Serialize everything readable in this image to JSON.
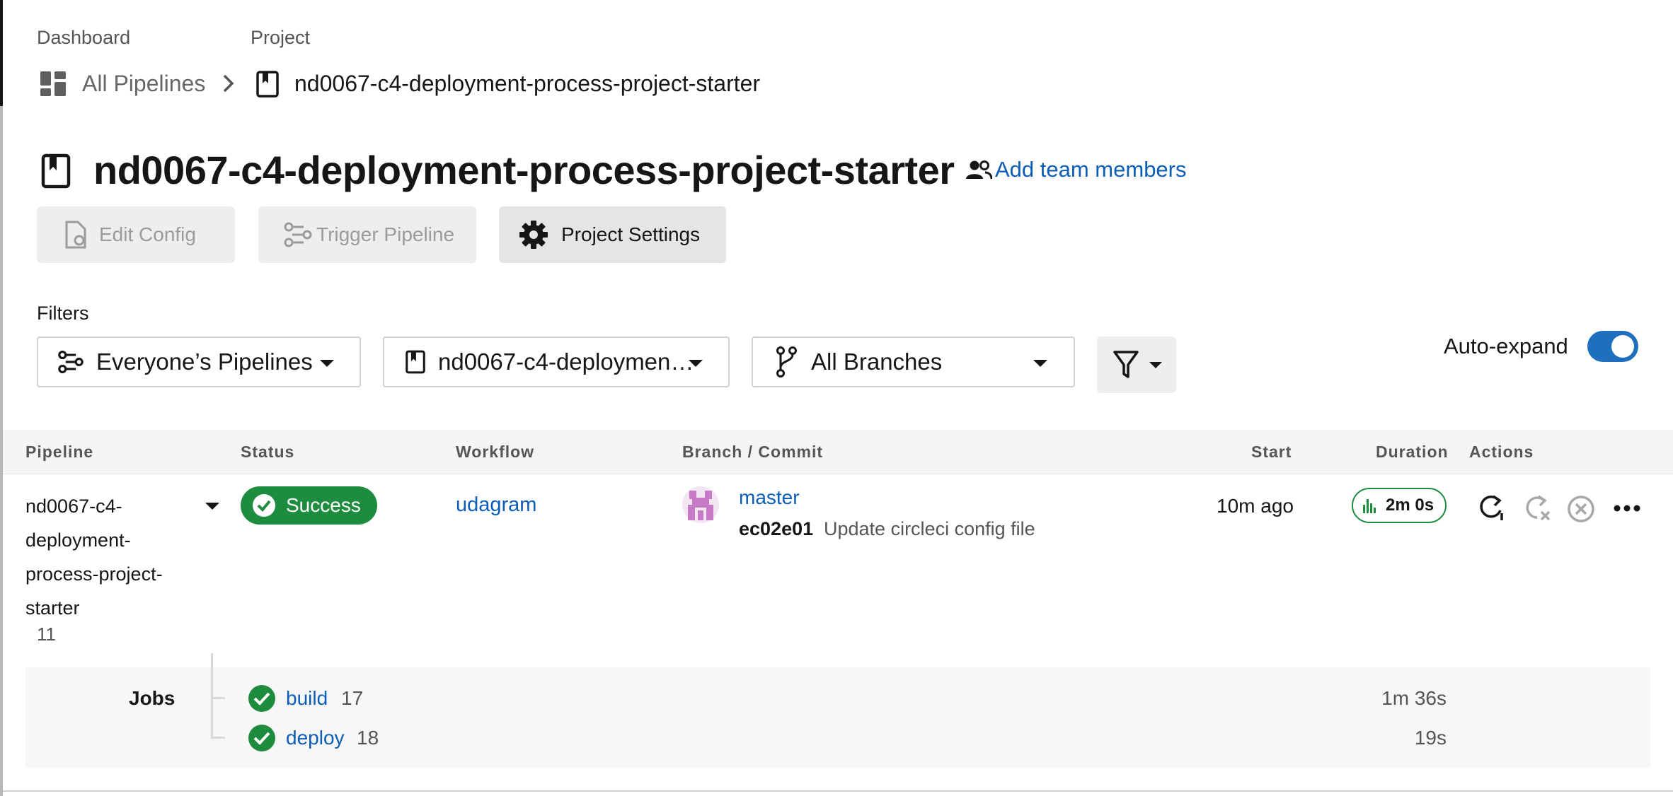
{
  "breadcrumb": {
    "dashboard_label": "Dashboard",
    "project_label": "Project",
    "all_pipelines": "All Pipelines",
    "project_name": "nd0067-c4-deployment-process-project-starter"
  },
  "header": {
    "title": "nd0067-c4-deployment-process-project-starter",
    "add_team": "Add team members"
  },
  "toolbar": {
    "edit_config": "Edit Config",
    "trigger_pipeline": "Trigger Pipeline",
    "project_settings": "Project Settings"
  },
  "filters": {
    "label": "Filters",
    "pipelines": "Everyone’s Pipelines",
    "project": "nd0067-c4-deploymen…",
    "branches": "All Branches",
    "auto_expand": "Auto-expand"
  },
  "table": {
    "headers": {
      "pipeline": "Pipeline",
      "status": "Status",
      "workflow": "Workflow",
      "branch_commit": "Branch / Commit",
      "start": "Start",
      "duration": "Duration",
      "actions": "Actions"
    },
    "row": {
      "pipeline_line1": "nd0067-c4-",
      "pipeline_line2": "deployment-",
      "pipeline_line3": "process-project-",
      "pipeline_line4": "starter",
      "pipeline_number": "11",
      "status": "Success",
      "workflow": "udagram",
      "branch": "master",
      "commit_hash": "ec02e01",
      "commit_message": "Update circleci config file",
      "start": "10m ago",
      "duration": "2m 0s"
    },
    "jobs": {
      "label": "Jobs",
      "items": [
        {
          "name": "build",
          "number": "17",
          "duration": "1m 36s"
        },
        {
          "name": "deploy",
          "number": "18",
          "duration": "19s"
        }
      ]
    }
  },
  "colors": {
    "success": "#1e8c3e",
    "link": "#0b5db6",
    "toggle": "#1f6fbf"
  }
}
